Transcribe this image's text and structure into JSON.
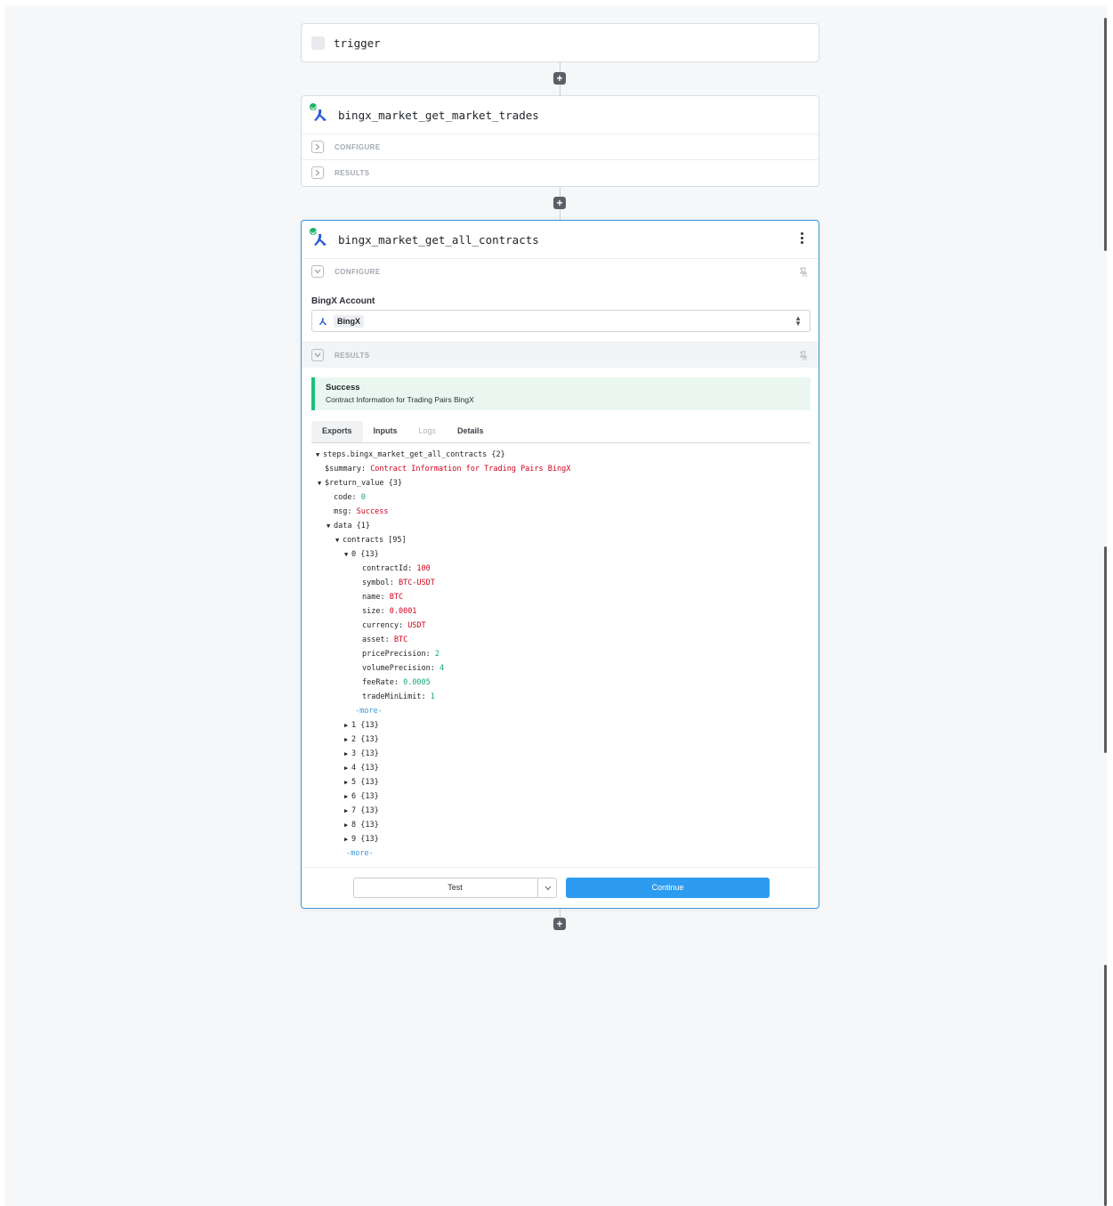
{
  "steps": {
    "trigger": {
      "title": "trigger"
    },
    "trades": {
      "title": "bingx_market_get_market_trades",
      "configure_label": "CONFIGURE",
      "results_label": "RESULTS"
    },
    "contracts": {
      "title": "bingx_market_get_all_contracts",
      "configure_label": "CONFIGURE",
      "results_label": "RESULTS",
      "account_label": "BingX Account",
      "account_value": "BingX",
      "alert": {
        "title": "Success",
        "message": "Contract Information for Trading Pairs BingX"
      },
      "tabs": [
        "Exports",
        "Inputs",
        "Logs",
        "Details"
      ],
      "tree": {
        "root": "steps.bingx_market_get_all_contracts {2}",
        "summary_key": "$summary:",
        "summary_val": "Contract Information for Trading Pairs BingX",
        "return_value": "$return_value {3}",
        "code_key": "code:",
        "code_val": "0",
        "msg_key": "msg:",
        "msg_val": "Success",
        "data": "data {1}",
        "contracts": "contracts [95]",
        "item0": "0 {13}",
        "fields": [
          {
            "k": "contractId:",
            "v": "100",
            "t": "str"
          },
          {
            "k": "symbol:",
            "v": "BTC-USDT",
            "t": "str"
          },
          {
            "k": "name:",
            "v": "BTC",
            "t": "str"
          },
          {
            "k": "size:",
            "v": "0.0001",
            "t": "str"
          },
          {
            "k": "currency:",
            "v": "USDT",
            "t": "str"
          },
          {
            "k": "asset:",
            "v": "BTC",
            "t": "str"
          },
          {
            "k": "pricePrecision:",
            "v": "2",
            "t": "num"
          },
          {
            "k": "volumePrecision:",
            "v": "4",
            "t": "num"
          },
          {
            "k": "feeRate:",
            "v": "0.0005",
            "t": "num"
          },
          {
            "k": "tradeMinLimit:",
            "v": "1",
            "t": "num"
          }
        ],
        "more": "-more-",
        "collapsed": [
          "1 {13}",
          "2 {13}",
          "3 {13}",
          "4 {13}",
          "5 {13}",
          "6 {13}",
          "7 {13}",
          "8 {13}",
          "9 {13}"
        ]
      },
      "test_label": "Test",
      "continue_label": "Continue"
    }
  },
  "colors": {
    "accent": "#2d9cf0",
    "success": "#1cc07a",
    "string": "#d0021b",
    "number": "#17a870"
  },
  "icons": [
    "bingx-logo-icon",
    "check-icon",
    "plus-icon",
    "chevron-right-icon",
    "chevron-down-icon",
    "pin-icon",
    "kebab-icon"
  ]
}
